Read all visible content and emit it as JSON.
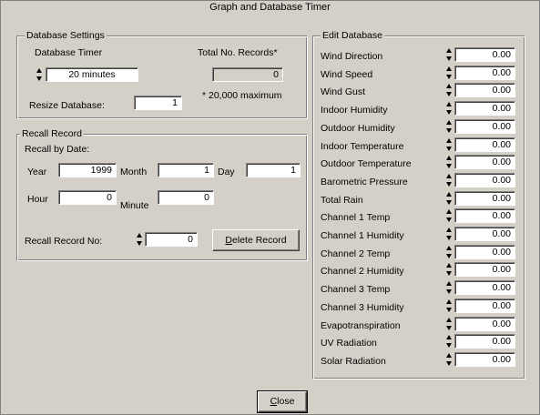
{
  "window": {
    "title": "Graph and Database Timer"
  },
  "database_settings": {
    "legend": "Database Settings",
    "timer_label": "Database Timer",
    "timer_value": "20 minutes",
    "total_records_label": "Total No. Records*",
    "total_records_value": "0",
    "maximum_note": "* 20,000 maximum",
    "resize_label": "Resize Database:",
    "resize_value": "1"
  },
  "recall_record": {
    "legend": "Recall Record",
    "recall_by_date_label": "Recall by Date:",
    "year_label": "Year",
    "year_value": "1999",
    "month_label": "Month",
    "month_value": "1",
    "day_label": "Day",
    "day_value": "1",
    "hour_label": "Hour",
    "hour_value": "0",
    "minute_label": "Minute",
    "minute_value": "0",
    "record_no_label": "Recall Record No:",
    "record_no_value": "0",
    "delete_button_prefix": "",
    "delete_button_mnemonic": "D",
    "delete_button_rest": "elete Record"
  },
  "edit_database": {
    "legend": "Edit Database",
    "rows": [
      {
        "label": "Wind Direction",
        "value": "0.00"
      },
      {
        "label": "Wind Speed",
        "value": "0.00"
      },
      {
        "label": "Wind Gust",
        "value": "0.00"
      },
      {
        "label": "Indoor Humidity",
        "value": "0.00"
      },
      {
        "label": "Outdoor Humidity",
        "value": "0.00"
      },
      {
        "label": "Indoor Temperature",
        "value": "0.00"
      },
      {
        "label": "Outdoor Temperature",
        "value": "0.00"
      },
      {
        "label": "Barometric Pressure",
        "value": "0.00"
      },
      {
        "label": "Total Rain",
        "value": "0.00"
      },
      {
        "label": "Channel 1 Temp",
        "value": "0.00"
      },
      {
        "label": "Channel 1 Humidity",
        "value": "0.00"
      },
      {
        "label": "Channel 2 Temp",
        "value": "0.00"
      },
      {
        "label": "Channel 2 Humidity",
        "value": "0.00"
      },
      {
        "label": "Channel 3 Temp",
        "value": "0.00"
      },
      {
        "label": "Channel 3 Humidity",
        "value": "0.00"
      },
      {
        "label": "Evapotranspiration",
        "value": "0.00"
      },
      {
        "label": "UV Radiation",
        "value": "0.00"
      },
      {
        "label": "Solar Radiation",
        "value": "0.00"
      }
    ]
  },
  "footer": {
    "close_mnemonic": "C",
    "close_rest": "lose"
  },
  "icons": {
    "spin_up": "spin-up-arrow-icon",
    "spin_down": "spin-down-arrow-icon"
  },
  "colors": {
    "face": "#d4d0c8",
    "shadow": "#808080",
    "highlight": "#ffffff",
    "field": "#ffffff"
  }
}
